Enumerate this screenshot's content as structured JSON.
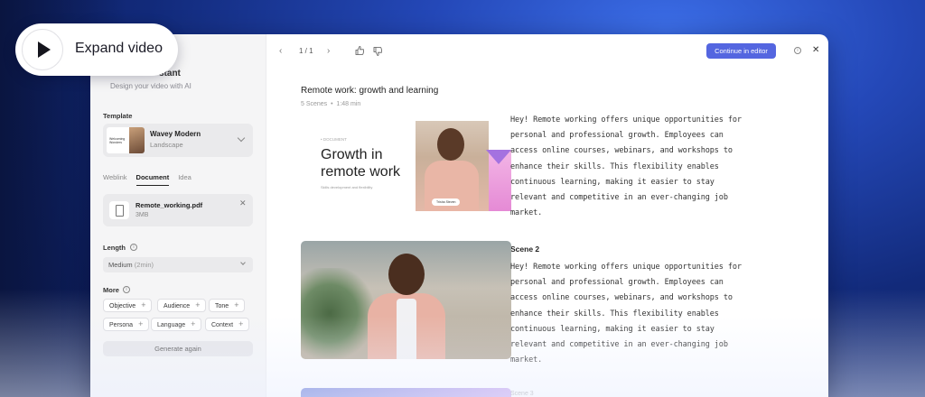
{
  "expand": {
    "label": "Expand video"
  },
  "sidebar": {
    "title": "stant",
    "subtitle": "Design your video with AI",
    "template_label": "Template",
    "template": {
      "name": "Wavey Modern",
      "orientation": "Landscape",
      "thumb_text": "Welcoming Wonders"
    },
    "source_tabs": [
      "Weblink",
      "Document",
      "Idea"
    ],
    "active_tab": "Document",
    "document": {
      "name": "Remote_working.pdf",
      "size": "3MB"
    },
    "length_label": "Length",
    "length_value": "Medium",
    "length_detail": "(2min)",
    "more_label": "More",
    "chips": [
      "Objective",
      "Audience",
      "Tone",
      "Persona",
      "Language",
      "Context"
    ],
    "generate_label": "Generate again"
  },
  "topbar": {
    "pager": "1 / 1",
    "continue_label": "Continue in editor"
  },
  "project": {
    "title": "Remote work: growth and learning",
    "scenes_count": "5 Scenes",
    "duration": "1:48 min"
  },
  "scene1": {
    "tag": "• DOCUMENT",
    "headline": "Growth in remote work",
    "small": "Skills development and flexibility",
    "badge": "Trisha Steven",
    "text": "Hey! Remote working offers unique opportunities for personal and professional growth. Employees can access online courses, webinars, and workshops to enhance their skills. This flexibility enables continuous learning, making it easier to stay relevant and competitive in an ever-changing job market."
  },
  "scene2": {
    "label": "Scene 2",
    "text": "Hey! Remote working offers unique opportunities for personal and professional growth. Employees can access online courses, webinars, and workshops to enhance their skills. This flexibility enables continuous learning, making it easier to stay relevant and competitive in an ever-changing job market."
  },
  "scene3": {
    "label": "Scene 3"
  },
  "colors": {
    "accent": "#5466e0",
    "background": "#1a3a9a"
  }
}
